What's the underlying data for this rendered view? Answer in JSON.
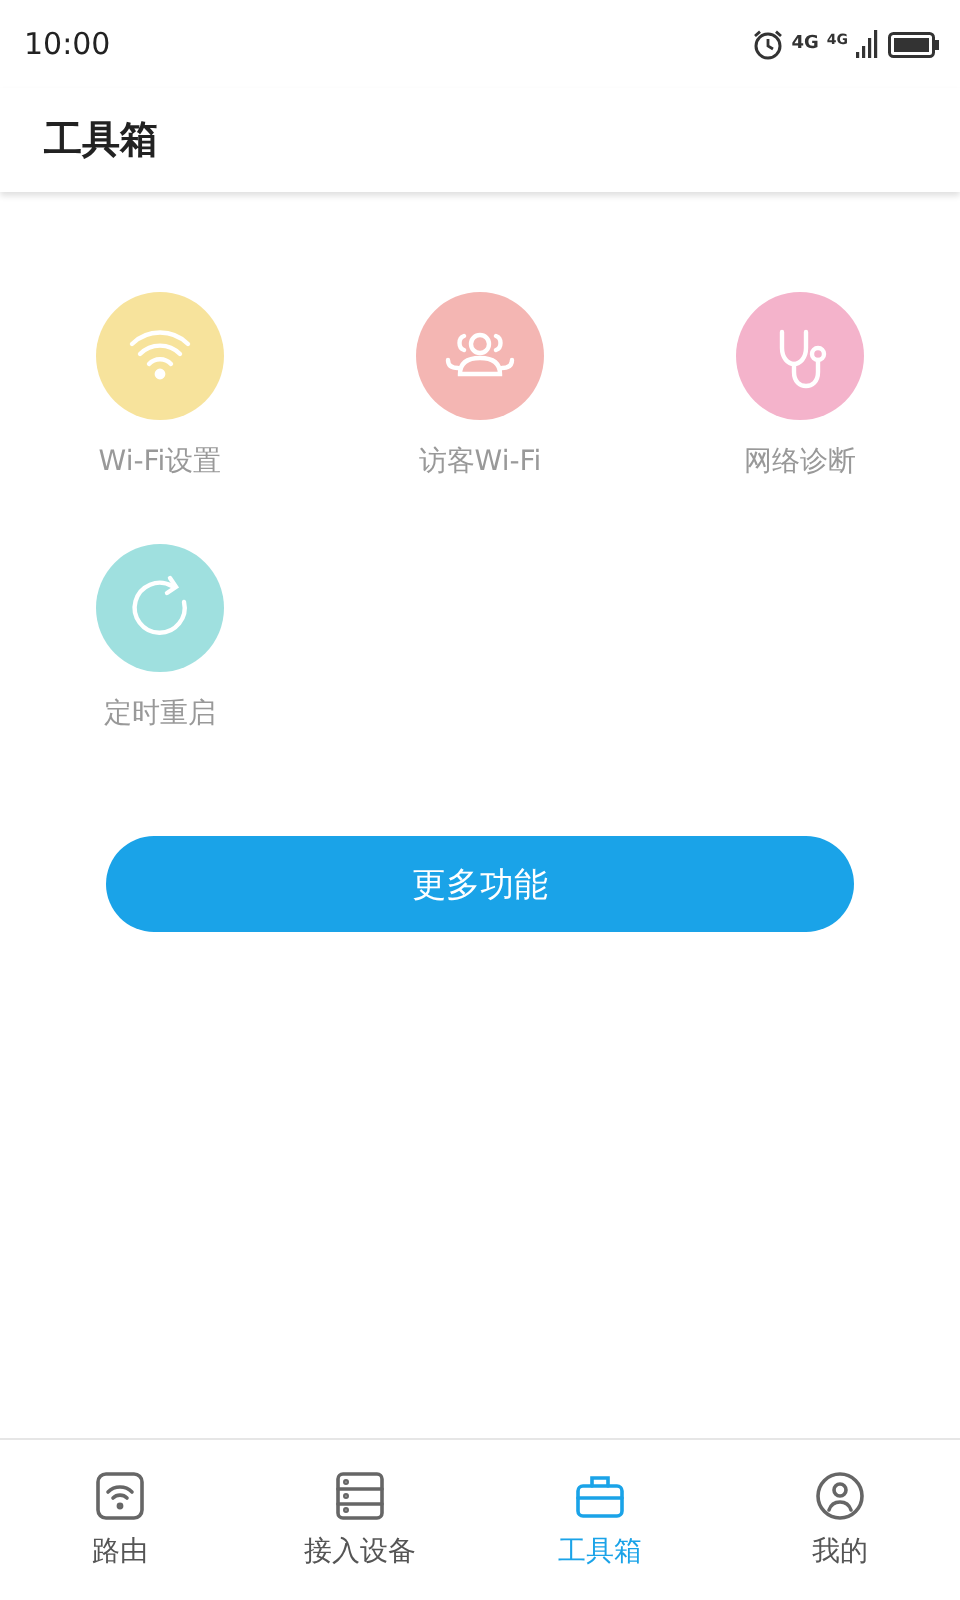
{
  "status_bar": {
    "time": "10:00",
    "network": "4G",
    "signal_network": "4G"
  },
  "header": {
    "title": "工具箱"
  },
  "tools": [
    {
      "label": "Wi-Fi设置",
      "kind": "wifi",
      "color": "#f7e39c"
    },
    {
      "label": "访客Wi-Fi",
      "kind": "guests",
      "color": "#f4b6b3"
    },
    {
      "label": "网络诊断",
      "kind": "stethoscope",
      "color": "#f4b3cb"
    },
    {
      "label": "定时重启",
      "kind": "restart",
      "color": "#9fe0df"
    }
  ],
  "more_button": {
    "label": "更多功能"
  },
  "tab_bar": [
    {
      "label": "路由",
      "kind": "router",
      "selected": false
    },
    {
      "label": "接入设备",
      "kind": "devices",
      "selected": false
    },
    {
      "label": "工具箱",
      "kind": "toolbox",
      "selected": true
    },
    {
      "label": "我的",
      "kind": "profile",
      "selected": false
    }
  ]
}
